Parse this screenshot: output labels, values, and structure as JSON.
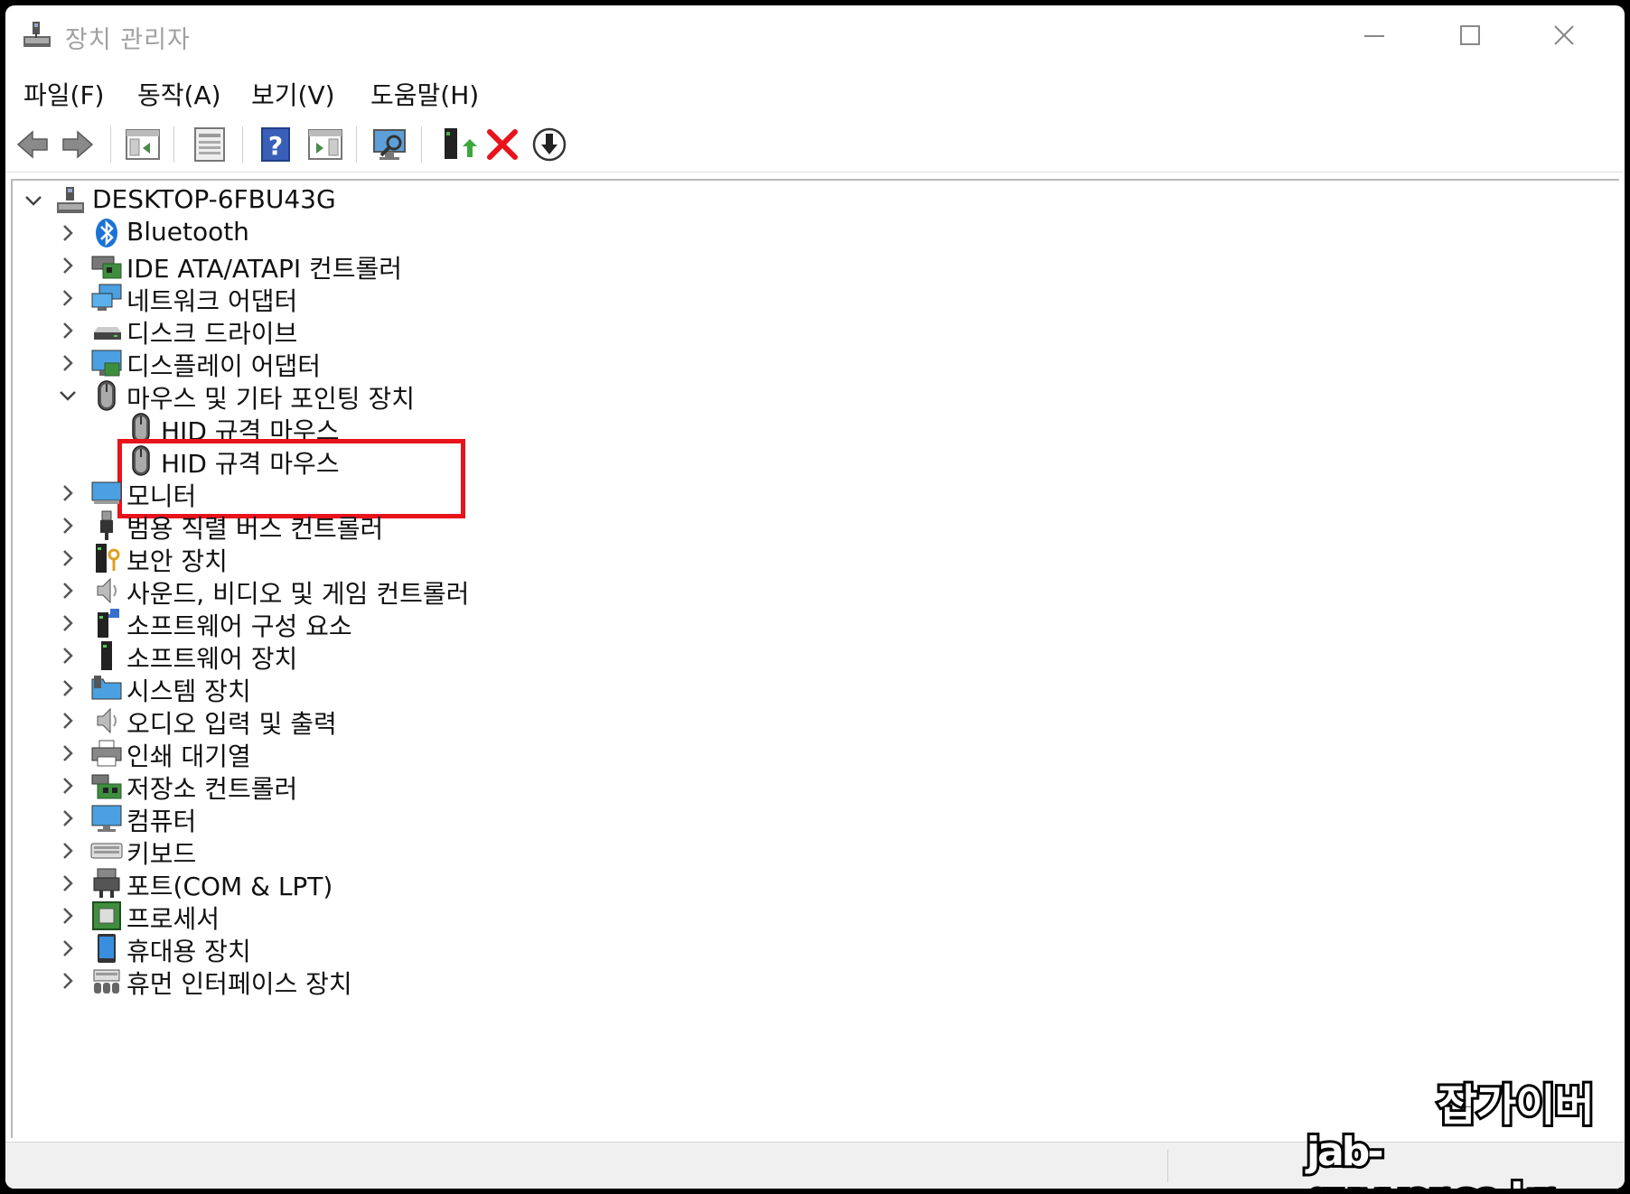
{
  "window": {
    "title": "장치 관리자"
  },
  "menu": {
    "items": [
      "파일(F)",
      "동작(A)",
      "보기(V)",
      "도움말(H)"
    ]
  },
  "toolbar": {
    "buttons": [
      "back-arrow-icon",
      "forward-arrow-icon",
      "show-hide-console-tree-icon",
      "properties-icon",
      "help-icon",
      "action-pane-icon",
      "scan-hardware-icon",
      "update-driver-icon",
      "uninstall-device-icon",
      "disable-device-icon"
    ],
    "uninstall_color": "#e8131b"
  },
  "tree": {
    "root": "DESKTOP-6FBU43G",
    "categories": [
      {
        "label": "Bluetooth",
        "icon": "bluetooth-icon"
      },
      {
        "label": "IDE ATA/ATAPI 컨트롤러",
        "icon": "ide-controller-icon"
      },
      {
        "label": "네트워크 어댑터",
        "icon": "network-adapter-icon"
      },
      {
        "label": "디스크 드라이브",
        "icon": "disk-drive-icon"
      },
      {
        "label": "디스플레이 어댑터",
        "icon": "display-adapter-icon"
      },
      {
        "label": "마우스 및 기타 포인팅 장치",
        "icon": "mouse-icon",
        "expanded": true,
        "children": [
          "HID 규격 마우스",
          "HID 규격 마우스"
        ]
      },
      {
        "label": "모니터",
        "icon": "monitor-icon"
      },
      {
        "label": "범용 직렬 버스 컨트롤러",
        "icon": "usb-icon"
      },
      {
        "label": "보안 장치",
        "icon": "security-device-icon"
      },
      {
        "label": "사운드, 비디오 및 게임 컨트롤러",
        "icon": "sound-icon"
      },
      {
        "label": "소프트웨어 구성 요소",
        "icon": "software-component-icon"
      },
      {
        "label": "소프트웨어 장치",
        "icon": "software-device-icon"
      },
      {
        "label": "시스템 장치",
        "icon": "system-device-icon"
      },
      {
        "label": "오디오 입력 및 출력",
        "icon": "audio-io-icon"
      },
      {
        "label": "인쇄 대기열",
        "icon": "print-queue-icon"
      },
      {
        "label": "저장소 컨트롤러",
        "icon": "storage-controller-icon"
      },
      {
        "label": "컴퓨터",
        "icon": "computer-icon"
      },
      {
        "label": "키보드",
        "icon": "keyboard-icon"
      },
      {
        "label": "포트(COM & LPT)",
        "icon": "port-icon"
      },
      {
        "label": "프로세서",
        "icon": "processor-icon"
      },
      {
        "label": "휴대용 장치",
        "icon": "portable-device-icon"
      },
      {
        "label": "휴먼 인터페이스 장치",
        "icon": "hid-icon"
      }
    ]
  },
  "highlight_color": "#e8131b",
  "watermark": {
    "line1": "잡가이버",
    "line2": "jab-guyver.co.kr"
  }
}
